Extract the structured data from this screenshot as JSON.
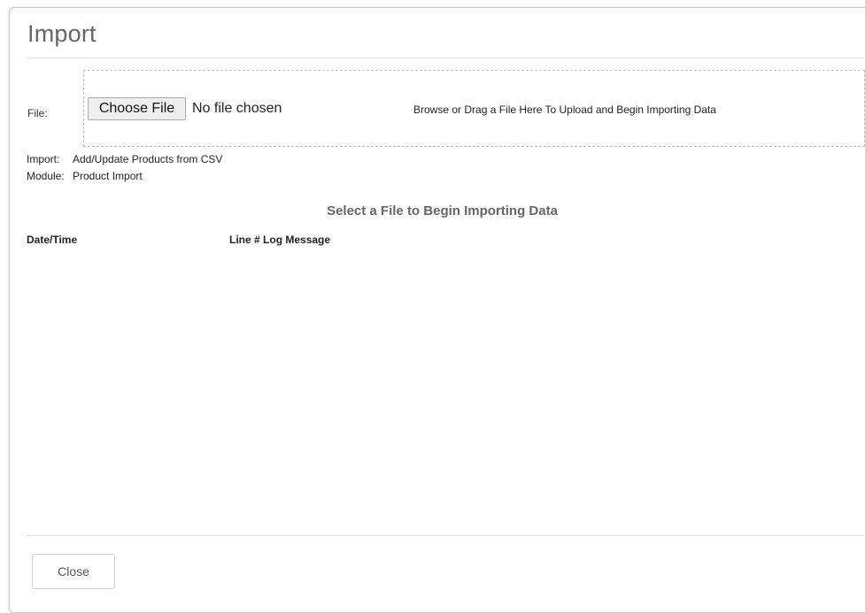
{
  "dialog": {
    "title": "Import"
  },
  "file_field": {
    "label": "File:",
    "button_label": "Choose File",
    "status": "No file chosen",
    "drop_hint": "Browse or Drag a File Here To Upload and Begin Importing Data"
  },
  "info": {
    "import_label": "Import:",
    "import_value": "Add/Update Products from CSV",
    "module_label": "Module:",
    "module_value": "Product Import"
  },
  "status_message": "Select a File to Begin Importing Data",
  "log_table": {
    "columns": [
      "Date/Time",
      "Line #",
      "Log Message"
    ],
    "rows": []
  },
  "footer": {
    "close_label": "Close"
  },
  "colors": {
    "title": "#666666",
    "status": "#666666",
    "border": "#c8c8c8"
  }
}
